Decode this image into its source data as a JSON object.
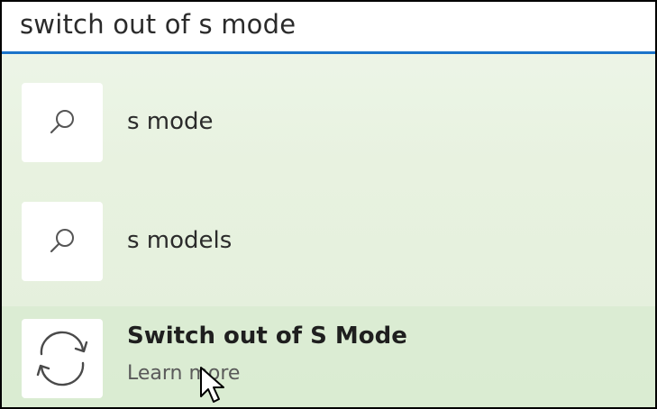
{
  "search": {
    "query": "switch out of s mode"
  },
  "results": [
    {
      "label": "s mode",
      "icon": "search-icon"
    },
    {
      "label": "s models",
      "icon": "search-icon"
    },
    {
      "label": "Switch out of S Mode",
      "sublabel": "Learn more",
      "icon": "refresh-icon",
      "selected": true
    }
  ],
  "colors": {
    "accent": "#1b74c9",
    "panel_background": "#e8f2e0",
    "tile_background": "#ffffff"
  }
}
